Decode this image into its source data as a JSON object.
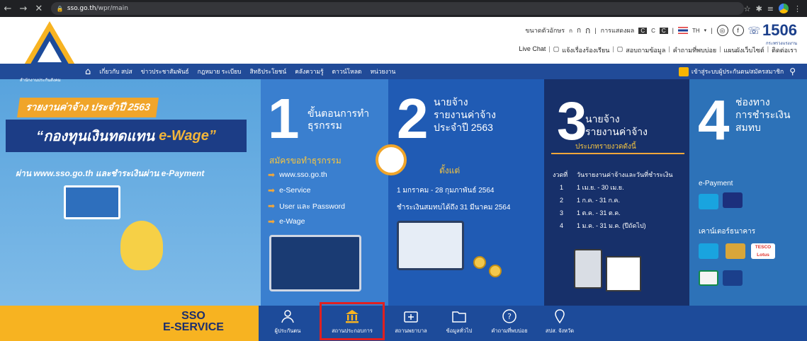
{
  "browser": {
    "url_host": "sso.go.th",
    "url_path": "/wpr/main"
  },
  "header": {
    "logo_caption": "สำนักงานประกันสังคม",
    "font_size_label": "ขนาดตัวอักษร",
    "font_sizes": [
      "ก",
      "ก",
      "ก"
    ],
    "display_label": "การแสดงผล",
    "lang": "TH",
    "hotline_number": "1506",
    "hotline_sub": "กระทรวงแรงงาน",
    "links": [
      "Live Chat",
      "แจ้งเรื่องร้องเรียน",
      "สอบถามข้อมูล",
      "คำถามที่พบบ่อย",
      "แผนผังเว็บไซต์",
      "ติดต่อเรา"
    ]
  },
  "navbar": {
    "items": [
      "เกี่ยวกับ สปส",
      "ข่าวประชาสัมพันธ์",
      "กฎหมาย ระเบียบ",
      "สิทธิประโยชน์",
      "คลังความรู้",
      "ดาวน์โหลด",
      "หน่วยงาน"
    ],
    "login_label": "เข้าสู่ระบบผู้ประกันตน/สมัครสมาชิก"
  },
  "banner": {
    "report_tag": "รายงานค่าจ้าง ประจำปี 2563",
    "fund_title": "“กองทุนเงินทดแทน",
    "fund_ewage": "e-Wage”",
    "tagline": "ผ่าน www.sso.go.th และชำระเงินผ่าน e-Payment",
    "step1_num": "1",
    "step1_title": "ขั้นตอนการทำธุรกรรม",
    "step1_subtitle": "สมัครขอทำธุรกรรม",
    "step1_items": [
      "www.sso.go.th",
      "e-Service",
      "User และ Password",
      "e-Wage"
    ],
    "step2_num": "2",
    "step2_title_1": "นายจ้าง",
    "step2_title_2": "รายงานค่าจ้าง",
    "step2_title_3": "ประจำปี 2563",
    "step2_since": "ตั้งแต่",
    "step2_date1": "1 มกราคม - 28 กุมภาพันธ์ 2564",
    "step2_date2": "ชำระเงินสมทบได้ถึง 31 มีนาคม 2564",
    "step3_num": "3",
    "step3_title_1": "นายจ้าง",
    "step3_title_2": "รายงานค่าจ้าง",
    "step3_sched_title": "ประเภทรายงวดดังนี้",
    "step3_sched_head": [
      "งวดที่",
      "วันรายงานค่าจ้างและวันที่ชำระเงิน"
    ],
    "step3_rows": [
      {
        "no": "1",
        "range": "1 เม.ย. - 30 เม.ย."
      },
      {
        "no": "2",
        "range": "1 ก.ค. - 31 ก.ค."
      },
      {
        "no": "3",
        "range": "1 ต.ค. - 31 ต.ค."
      },
      {
        "no": "4",
        "range": "1 ม.ค. - 31 ม.ค. (ปีถัดไป)"
      }
    ],
    "step4_num": "4",
    "step4_title_1": "ช่องทาง",
    "step4_title_2": "การชำระเงิน",
    "step4_title_3": "สมทบ",
    "step4_epayment": "e-Payment",
    "step4_counter": "เคาน์เตอร์ธนาคาร",
    "tesco_label": "TESCO Lotus"
  },
  "eservice": {
    "brand_1": "SSO",
    "brand_2": "E-SERVICE",
    "items": [
      "ผู้ประกันตน",
      "สถานประกอบการ",
      "สถานพยาบาล",
      "ข้อมูลทั่วไป",
      "คำถามที่พบบ่อย",
      "สปส. จังหวัด"
    ],
    "highlighted_index": 1
  },
  "colors": {
    "navbar": "#214b98",
    "brand_yellow": "#f7b321",
    "highlight_border": "#e02020"
  }
}
